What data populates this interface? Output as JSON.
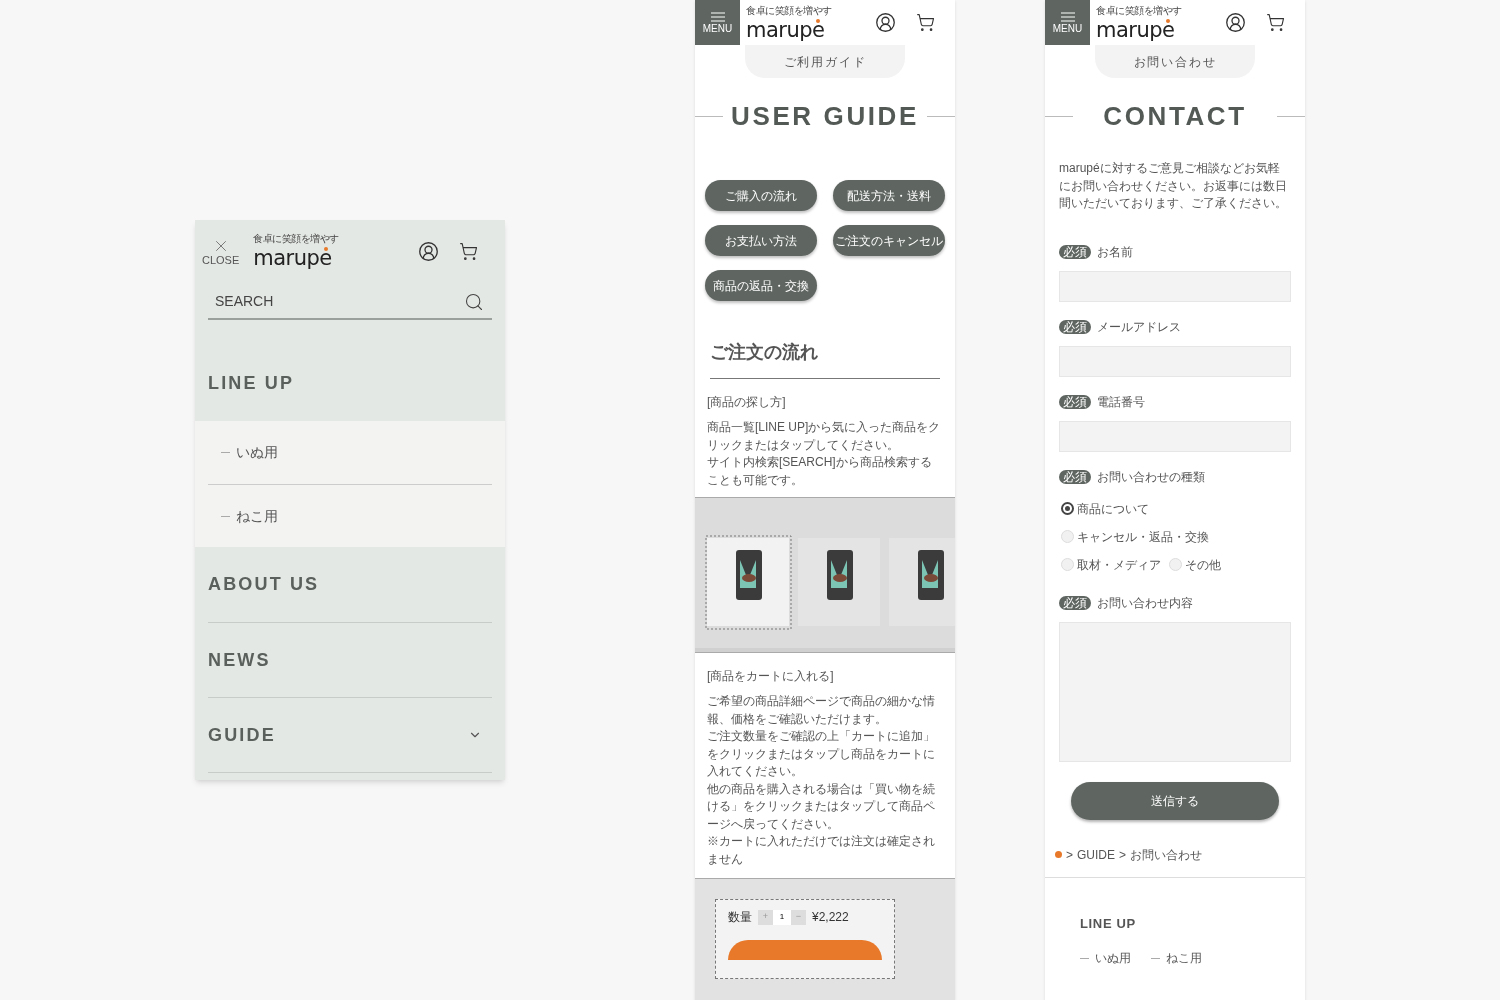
{
  "menu_panel": {
    "close_label": "CLOSE",
    "logo": {
      "tagline": "食卓に笑顔を増やす",
      "name": "marupe"
    },
    "search": {
      "placeholder": "SEARCH"
    },
    "items": [
      {
        "label": "LINE UP",
        "expanded": true,
        "children": [
          {
            "label": "いぬ用"
          },
          {
            "label": "ねこ用"
          }
        ]
      },
      {
        "label": "ABOUT US"
      },
      {
        "label": "NEWS"
      },
      {
        "label": "GUIDE",
        "expanded": false
      }
    ]
  },
  "guide_page": {
    "menu_label": "MENU",
    "logo": {
      "tagline": "食卓に笑顔を増やす",
      "name": "marupe"
    },
    "tab": "ご利用ガイド",
    "title": "USER GUIDE",
    "links": [
      "ご購入の流れ",
      "配送方法・送料",
      "お支払い方法",
      "ご注文のキャンセル",
      "商品の返品・交換"
    ],
    "section_title": "ご注文の流れ",
    "steps": [
      {
        "heading": "[商品の探し方]",
        "body": [
          "商品一覧[LINE UP]から気に入った商品をクリックまたはタップしてください。",
          "サイト内検索[SEARCH]から商品検索することも可能です。"
        ]
      },
      {
        "heading": "[商品をカートに入れる]",
        "body": [
          "ご希望の商品詳細ページで商品の細かな情報、価格をご確認いただけます。",
          "ご注文数量をご確認の上「カートに追加」をクリックまたはタップし商品をカートに入れてください。",
          "他の商品を購入される場合は「買い物を続ける」をクリックまたはタップして商品ページへ戻ってください。",
          "※カートに入れただけでは注文は確定されません"
        ]
      }
    ],
    "cart_preview": {
      "quantity_label": "数量",
      "plus": "+",
      "quantity": "1",
      "minus": "−",
      "price": "¥2,222"
    }
  },
  "contact_page": {
    "menu_label": "MENU",
    "logo": {
      "tagline": "食卓に笑顔を増やす",
      "name": "marupe"
    },
    "tab": "お問い合わせ",
    "title": "CONTACT",
    "intro": "marupéに対するご意見ご相談などお気軽にお問い合わせください。お返事には数日間いただいております、ご了承ください。",
    "fields": [
      {
        "badge": "必須",
        "label": "お名前",
        "kind": "text"
      },
      {
        "badge": "必須",
        "label": "メールアドレス",
        "kind": "text"
      },
      {
        "badge": "必須",
        "label": "電話番号",
        "kind": "text"
      },
      {
        "badge": "必須",
        "label": "お問い合わせの種類",
        "kind": "radio",
        "options": [
          {
            "label": "商品について",
            "selected": true
          },
          {
            "label": "キャンセル・返品・交換",
            "selected": false
          },
          {
            "label": "取材・メディア",
            "selected": false
          },
          {
            "label": "その他",
            "selected": false
          }
        ]
      },
      {
        "badge": "必須",
        "label": "お問い合わせ内容",
        "kind": "textarea"
      }
    ],
    "submit": "送信する",
    "breadcrumb": [
      ">",
      "GUIDE",
      ">",
      "お問い合わせ"
    ],
    "footer": {
      "title": "LINE UP",
      "links": [
        "いぬ用",
        "ねこ用"
      ]
    }
  }
}
